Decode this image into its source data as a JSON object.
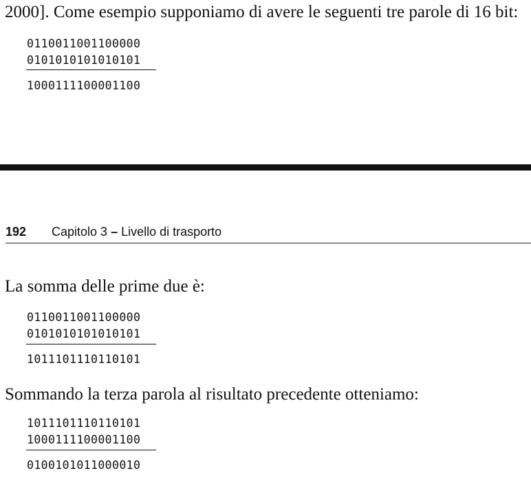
{
  "page_top": {
    "intro_text": "2000]. Come esempio supponiamo di avere le seguenti tre parole di 16 bit:",
    "words": [
      "0110011001100000",
      "0101010101010101"
    ],
    "third_word": "1000111100001100"
  },
  "header": {
    "page_number": "192",
    "chapter_prefix": "Capitolo 3",
    "dash": "–",
    "chapter_title": "Livello di trasporto"
  },
  "first_sum": {
    "text": "La somma delle prime due è:",
    "addend_1": "0110011001100000",
    "addend_2": "0101010101010101",
    "result": "1011101110110101"
  },
  "second_sum": {
    "text": "Sommando la terza parola al risultato precedente otteniamo:",
    "addend_1": "1011101110110101",
    "addend_2": "1000111100001100",
    "result": "0100101011000010"
  }
}
